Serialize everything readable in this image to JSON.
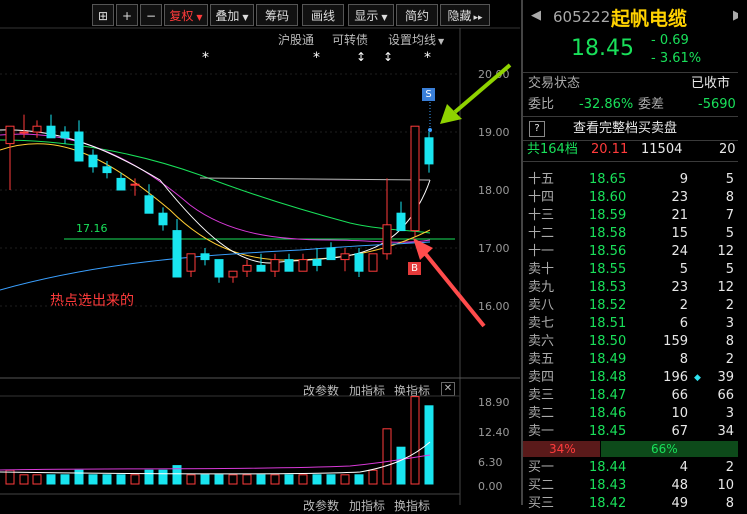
{
  "toolbar": {
    "grid_icon": "⊞",
    "plus": "+",
    "minus": "−",
    "fuquan": "复权",
    "diejia": "叠加",
    "chouma": "筹码",
    "huaxian": "画线",
    "xianshi": "显示",
    "jianyue": "简约",
    "yincang": "隐藏",
    "more": "▸▸"
  },
  "subbar": {
    "hugutong": "沪股通",
    "kezhuanzhai": "可转债",
    "shezhi": "设置均线"
  },
  "markers": {
    "star": "*",
    "up_down": "↕"
  },
  "chart": {
    "price_axis": [
      "20.00",
      "19.00",
      "18.00",
      "17.00",
      "16.00"
    ],
    "level_label": "17.16",
    "annotation": "热点选出来的",
    "s_badge": "S",
    "b_badge": "B",
    "colors": {
      "up": "#ff3b3b",
      "down": "#19e5f0",
      "arrow_green": "#8fd300",
      "arrow_red": "#ff4c4c"
    }
  },
  "subchart": {
    "gai_canshu": "改参数",
    "jia_zhibiao": "加指标",
    "huan_zhibiao": "换指标",
    "axis": [
      "18.90",
      "12.40",
      "6.30",
      "0.00"
    ]
  },
  "header": {
    "code": "605222",
    "name": "起帆电缆",
    "price": "18.45",
    "change": "- 0.69",
    "change_pct": "- 3.61%",
    "left_arrow": "◀",
    "right_arrow": "▶"
  },
  "status": {
    "label": "交易状态",
    "value": "已收市"
  },
  "ratio": {
    "weibi_label": "委比",
    "weibi_value": "-32.86%",
    "weicha_label": "委差",
    "weicha_value": "-5690"
  },
  "full_book": {
    "icon": "?",
    "label": "查看完整档买卖盘"
  },
  "total": {
    "label": "共164档",
    "price": "20.11",
    "vol": "11504",
    "count": "20"
  },
  "sell_levels": [
    {
      "label": "十五",
      "price": "18.65",
      "vol": "9",
      "cnt": "5"
    },
    {
      "label": "十四",
      "price": "18.60",
      "vol": "23",
      "cnt": "8"
    },
    {
      "label": "十三",
      "price": "18.59",
      "vol": "21",
      "cnt": "7"
    },
    {
      "label": "十二",
      "price": "18.58",
      "vol": "15",
      "cnt": "5"
    },
    {
      "label": "十一",
      "price": "18.56",
      "vol": "24",
      "cnt": "12"
    },
    {
      "label": "卖十",
      "price": "18.55",
      "vol": "5",
      "cnt": "5"
    },
    {
      "label": "卖九",
      "price": "18.53",
      "vol": "23",
      "cnt": "12"
    },
    {
      "label": "卖八",
      "price": "18.52",
      "vol": "2",
      "cnt": "2"
    },
    {
      "label": "卖七",
      "price": "18.51",
      "vol": "6",
      "cnt": "3"
    },
    {
      "label": "卖六",
      "price": "18.50",
      "vol": "159",
      "cnt": "8"
    },
    {
      "label": "卖五",
      "price": "18.49",
      "vol": "8",
      "cnt": "2"
    },
    {
      "label": "卖四",
      "price": "18.48",
      "vol": "196",
      "cnt": "39"
    },
    {
      "label": "卖三",
      "price": "18.47",
      "vol": "66",
      "cnt": "66"
    },
    {
      "label": "卖二",
      "price": "18.46",
      "vol": "10",
      "cnt": "3"
    },
    {
      "label": "卖一",
      "price": "18.45",
      "vol": "67",
      "cnt": "34"
    }
  ],
  "bidask": {
    "left": "34%",
    "right": "66%",
    "left_ratio": 0.34
  },
  "buy_levels": [
    {
      "label": "买一",
      "price": "18.44",
      "vol": "4",
      "cnt": "2"
    },
    {
      "label": "买二",
      "price": "18.43",
      "vol": "48",
      "cnt": "10"
    },
    {
      "label": "买三",
      "price": "18.42",
      "vol": "49",
      "cnt": "8"
    }
  ]
}
